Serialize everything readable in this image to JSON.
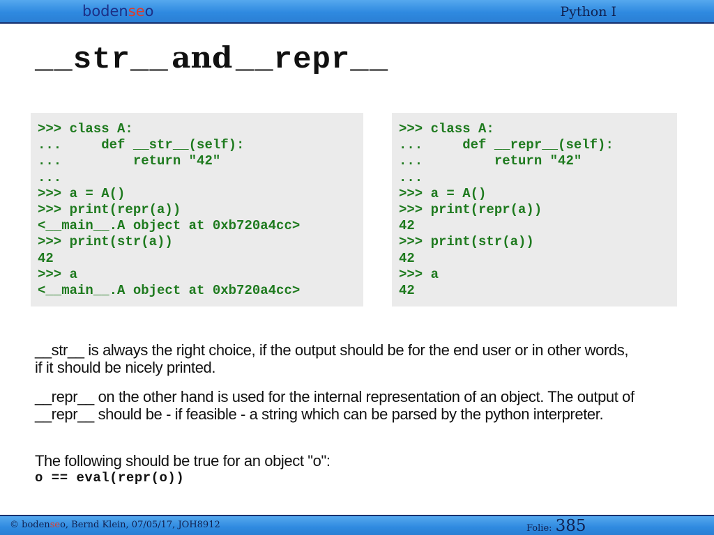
{
  "header": {
    "logo": {
      "part1": "boden",
      "part2": "se",
      "part3": "o"
    },
    "course": "Python I"
  },
  "title": {
    "part1": "__str__",
    "part2": "and",
    "part3": "__repr__"
  },
  "code_left": [
    ">>> class A:",
    "...     def __str__(self):",
    "...         return \"42\"",
    "...",
    ">>> a = A()",
    ">>> print(repr(a))",
    "<__main__.A object at 0xb720a4cc>",
    ">>> print(str(a))",
    "42",
    ">>> a",
    "<__main__.A object at 0xb720a4cc>"
  ],
  "code_right": [
    ">>> class A:",
    "...     def __repr__(self):",
    "...         return \"42\"",
    "...",
    ">>> a = A()",
    ">>> print(repr(a))",
    "42",
    ">>> print(str(a))",
    "42",
    ">>> a",
    "42"
  ],
  "paragraphs": {
    "p1": "__str__ is always the right choice, if the output should be for the end user or in other words, if it should be nicely printed.",
    "p2": "__repr__ on the other hand is used for the internal representation of an object. The output of __repr__ should be - if feasible - a string which can be parsed by the python interpreter.",
    "p3": "The following should be true for an object \"o\":",
    "p3_code": "o == eval(repr(o))"
  },
  "footer": {
    "copyright": "©",
    "brand1": "boden",
    "brand2": "se",
    "brand3": "o",
    "author_info": ", Bernd Klein, 07/05/17, JOH8912",
    "folie_label": "Folie:",
    "folie_number": "385"
  },
  "colors": {
    "accent_blue": "#2f8ae0",
    "brand_red": "#e23a26",
    "code_green": "#1e7a1e",
    "code_bg": "#ebebeb"
  }
}
